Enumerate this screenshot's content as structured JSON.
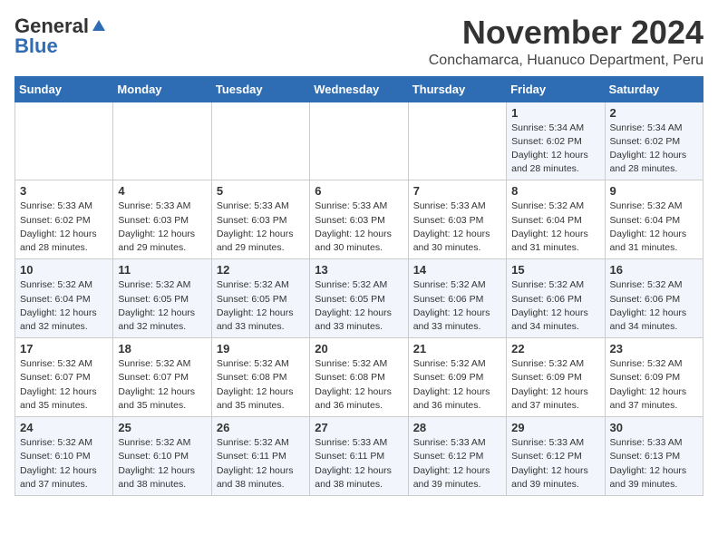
{
  "header": {
    "logo_general": "General",
    "logo_blue": "Blue",
    "month_title": "November 2024",
    "location": "Conchamarca, Huanuco Department, Peru"
  },
  "weekdays": [
    "Sunday",
    "Monday",
    "Tuesday",
    "Wednesday",
    "Thursday",
    "Friday",
    "Saturday"
  ],
  "weeks": [
    [
      {
        "day": "",
        "info": ""
      },
      {
        "day": "",
        "info": ""
      },
      {
        "day": "",
        "info": ""
      },
      {
        "day": "",
        "info": ""
      },
      {
        "day": "",
        "info": ""
      },
      {
        "day": "1",
        "info": "Sunrise: 5:34 AM\nSunset: 6:02 PM\nDaylight: 12 hours and 28 minutes."
      },
      {
        "day": "2",
        "info": "Sunrise: 5:34 AM\nSunset: 6:02 PM\nDaylight: 12 hours and 28 minutes."
      }
    ],
    [
      {
        "day": "3",
        "info": "Sunrise: 5:33 AM\nSunset: 6:02 PM\nDaylight: 12 hours and 28 minutes."
      },
      {
        "day": "4",
        "info": "Sunrise: 5:33 AM\nSunset: 6:03 PM\nDaylight: 12 hours and 29 minutes."
      },
      {
        "day": "5",
        "info": "Sunrise: 5:33 AM\nSunset: 6:03 PM\nDaylight: 12 hours and 29 minutes."
      },
      {
        "day": "6",
        "info": "Sunrise: 5:33 AM\nSunset: 6:03 PM\nDaylight: 12 hours and 30 minutes."
      },
      {
        "day": "7",
        "info": "Sunrise: 5:33 AM\nSunset: 6:03 PM\nDaylight: 12 hours and 30 minutes."
      },
      {
        "day": "8",
        "info": "Sunrise: 5:32 AM\nSunset: 6:04 PM\nDaylight: 12 hours and 31 minutes."
      },
      {
        "day": "9",
        "info": "Sunrise: 5:32 AM\nSunset: 6:04 PM\nDaylight: 12 hours and 31 minutes."
      }
    ],
    [
      {
        "day": "10",
        "info": "Sunrise: 5:32 AM\nSunset: 6:04 PM\nDaylight: 12 hours and 32 minutes."
      },
      {
        "day": "11",
        "info": "Sunrise: 5:32 AM\nSunset: 6:05 PM\nDaylight: 12 hours and 32 minutes."
      },
      {
        "day": "12",
        "info": "Sunrise: 5:32 AM\nSunset: 6:05 PM\nDaylight: 12 hours and 33 minutes."
      },
      {
        "day": "13",
        "info": "Sunrise: 5:32 AM\nSunset: 6:05 PM\nDaylight: 12 hours and 33 minutes."
      },
      {
        "day": "14",
        "info": "Sunrise: 5:32 AM\nSunset: 6:06 PM\nDaylight: 12 hours and 33 minutes."
      },
      {
        "day": "15",
        "info": "Sunrise: 5:32 AM\nSunset: 6:06 PM\nDaylight: 12 hours and 34 minutes."
      },
      {
        "day": "16",
        "info": "Sunrise: 5:32 AM\nSunset: 6:06 PM\nDaylight: 12 hours and 34 minutes."
      }
    ],
    [
      {
        "day": "17",
        "info": "Sunrise: 5:32 AM\nSunset: 6:07 PM\nDaylight: 12 hours and 35 minutes."
      },
      {
        "day": "18",
        "info": "Sunrise: 5:32 AM\nSunset: 6:07 PM\nDaylight: 12 hours and 35 minutes."
      },
      {
        "day": "19",
        "info": "Sunrise: 5:32 AM\nSunset: 6:08 PM\nDaylight: 12 hours and 35 minutes."
      },
      {
        "day": "20",
        "info": "Sunrise: 5:32 AM\nSunset: 6:08 PM\nDaylight: 12 hours and 36 minutes."
      },
      {
        "day": "21",
        "info": "Sunrise: 5:32 AM\nSunset: 6:09 PM\nDaylight: 12 hours and 36 minutes."
      },
      {
        "day": "22",
        "info": "Sunrise: 5:32 AM\nSunset: 6:09 PM\nDaylight: 12 hours and 37 minutes."
      },
      {
        "day": "23",
        "info": "Sunrise: 5:32 AM\nSunset: 6:09 PM\nDaylight: 12 hours and 37 minutes."
      }
    ],
    [
      {
        "day": "24",
        "info": "Sunrise: 5:32 AM\nSunset: 6:10 PM\nDaylight: 12 hours and 37 minutes."
      },
      {
        "day": "25",
        "info": "Sunrise: 5:32 AM\nSunset: 6:10 PM\nDaylight: 12 hours and 38 minutes."
      },
      {
        "day": "26",
        "info": "Sunrise: 5:32 AM\nSunset: 6:11 PM\nDaylight: 12 hours and 38 minutes."
      },
      {
        "day": "27",
        "info": "Sunrise: 5:33 AM\nSunset: 6:11 PM\nDaylight: 12 hours and 38 minutes."
      },
      {
        "day": "28",
        "info": "Sunrise: 5:33 AM\nSunset: 6:12 PM\nDaylight: 12 hours and 39 minutes."
      },
      {
        "day": "29",
        "info": "Sunrise: 5:33 AM\nSunset: 6:12 PM\nDaylight: 12 hours and 39 minutes."
      },
      {
        "day": "30",
        "info": "Sunrise: 5:33 AM\nSunset: 6:13 PM\nDaylight: 12 hours and 39 minutes."
      }
    ]
  ]
}
